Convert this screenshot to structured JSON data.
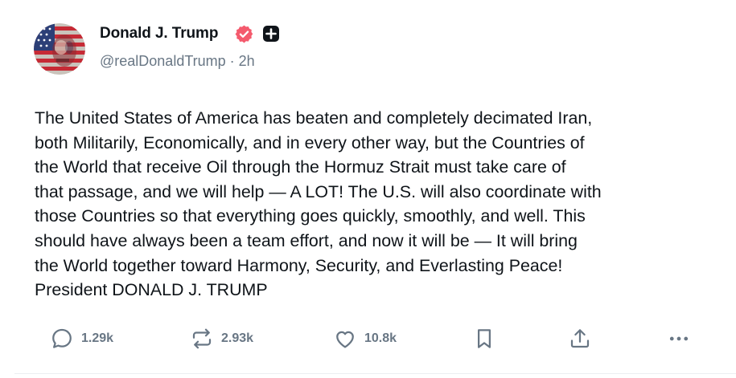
{
  "author": {
    "display_name": "Donald J. Trump",
    "handle": "@realDonaldTrump",
    "separator": "·",
    "time_ago": "2h",
    "verified_icon": "verified-badge-icon",
    "verified_color": "#f45a6d",
    "extra_badge_icon": "plus-badge-icon"
  },
  "post": {
    "lines": [
      "The United States of America has beaten and completely decimated Iran,",
      "both Militarily, Economically, and in every other way, but the Countries of",
      "the World that receive Oil through the Hormuz Strait must take care of",
      "that passage, and we will help — A LOT! The U.S. will also coordinate with",
      "those Countries so that everything goes quickly, smoothly, and well. This",
      "should have always been a team effort, and now it will be — It will bring",
      "the World together toward Harmony, Security, and Everlasting Peace!",
      "President DONALD J. TRUMP"
    ]
  },
  "actions": {
    "reply": {
      "icon": "reply-icon",
      "count": "1.29k"
    },
    "repost": {
      "icon": "repost-icon",
      "count": "2.93k"
    },
    "like": {
      "icon": "heart-icon",
      "count": "10.8k"
    },
    "bookmark": {
      "icon": "bookmark-icon"
    },
    "share": {
      "icon": "share-icon"
    },
    "more": {
      "icon": "more-icon"
    }
  },
  "colors": {
    "text": "#0f1419",
    "muted": "#687684",
    "divider": "#eceff1"
  }
}
